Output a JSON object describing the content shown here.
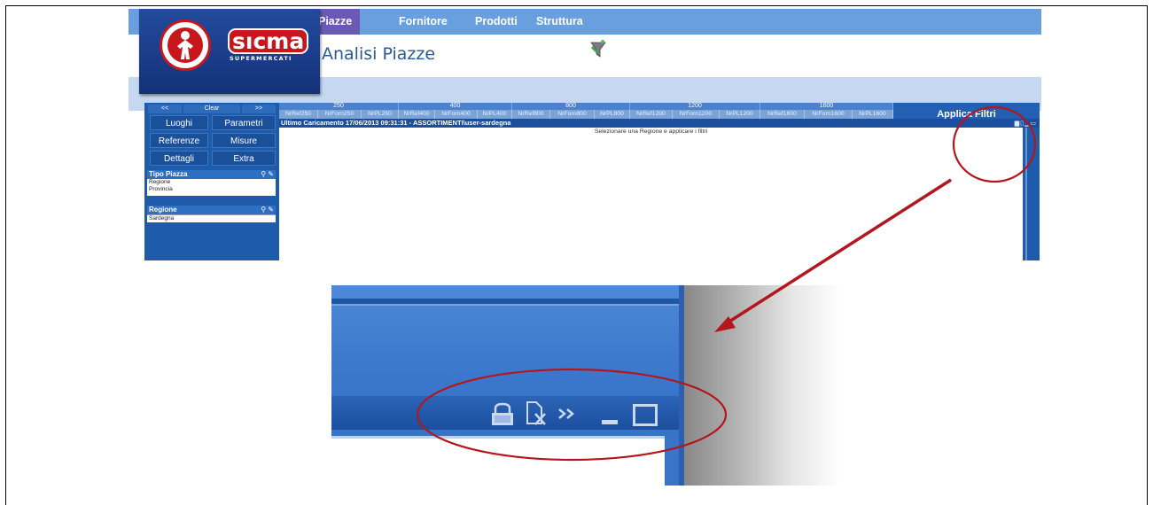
{
  "nav": {
    "items": [
      {
        "label": "Piazze",
        "active": true
      },
      {
        "label": "Fornitore",
        "active": false
      },
      {
        "label": "Prodotti",
        "active": false
      },
      {
        "label": "Struttura",
        "active": false
      }
    ]
  },
  "header": {
    "title": "Analisi Piazze",
    "icon": "funnel-icon"
  },
  "logo": {
    "word": "sıcma",
    "sub": "SUPERMERCATI",
    "brand_color": "#c8161d",
    "bg_color": "#234b9c"
  },
  "leftpanel": {
    "nav_prev": "<<",
    "clear": "Clear",
    "nav_next": ">>",
    "buttons": [
      "Luoghi",
      "Parametri",
      "Referenze",
      "Misure",
      "Dettagli",
      "Extra"
    ],
    "filters": [
      {
        "title": "Tipo Piazza",
        "items": [
          "Regione",
          "Provincia"
        ],
        "selected": null
      },
      {
        "title": "Regione",
        "items": [
          "Sardegna"
        ],
        "selected": "Sardegna"
      }
    ]
  },
  "grid": {
    "groups": [
      "250",
      "400",
      "800",
      "1200",
      "1600"
    ],
    "columns": [
      "NrRef250",
      "NrForn250",
      "NrPL250",
      "NrRef400",
      "NrForn400",
      "NrPL400",
      "NrRef800",
      "NrForn800",
      "NrPL800",
      "NrRef1200",
      "NrForn1200",
      "NrPL1200",
      "NrRef1600",
      "NrForn1600",
      "NrPL1600"
    ],
    "apply_label": "Applica Filtri",
    "status": "Ultimo Caricamento 17/06/2013 09:31:31 - ASSORTIMENTI\\user-sardegna",
    "message": "Selezionare una Regione e applicare i filtri"
  },
  "zoom": {
    "icons": [
      "lock-icon",
      "export-icon",
      "expand-icon",
      "minimize-icon",
      "maximize-icon"
    ]
  },
  "colors": {
    "nav_bg": "#6a9fdf",
    "nav_active": "#6a5ab5",
    "panel_blue": "#1f5bab",
    "annotation_red": "#b3161c"
  }
}
